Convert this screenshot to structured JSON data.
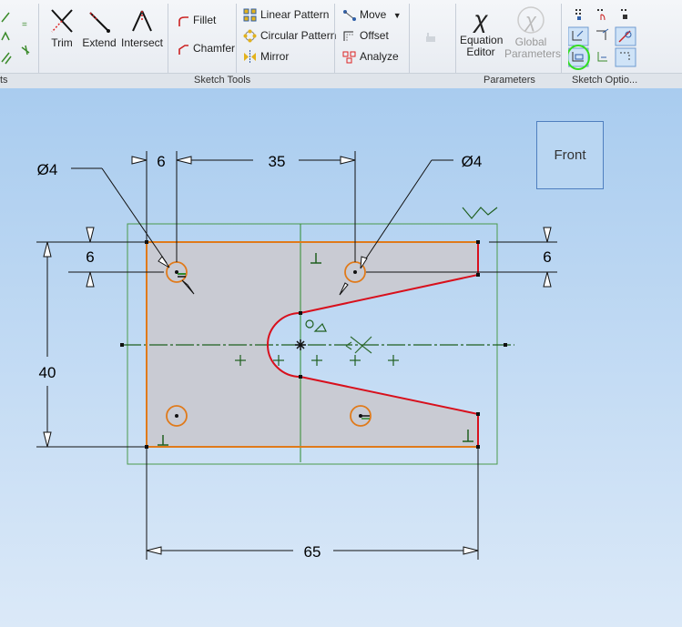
{
  "ribbon": {
    "groups": {
      "sketch_tools": "Sketch Tools",
      "parameters": "Parameters",
      "sketch_options": "Sketch Optio...",
      "left_partial": "ts"
    },
    "buttons": {
      "trim": "Trim",
      "extend": "Extend",
      "intersect": "Intersect",
      "fillet": "Fillet",
      "chamfer": "Chamfer",
      "linear_pattern": "Linear Pattern",
      "circular_pattern": "Circular Pattern",
      "mirror": "Mirror",
      "move": "Move",
      "offset": "Offset",
      "analyze": "Analyze",
      "equation_editor_line1": "Equation",
      "equation_editor_line2": "Editor",
      "global_parameters_line1": "Global",
      "global_parameters_line2": "Parameters"
    }
  },
  "viewcube": {
    "label": "Front"
  },
  "dimensions": {
    "dia_left": "Ø4",
    "dia_right": "Ø4",
    "d6_top": "6",
    "d35": "35",
    "d6_left": "6",
    "d6_right": "6",
    "d40": "40",
    "d65": "65"
  },
  "colors": {
    "profile_orange": "#e07a1a",
    "profile_red": "#d8101c",
    "construction_green": "#2e8b2e",
    "accent_highlight": "#33dd22"
  }
}
